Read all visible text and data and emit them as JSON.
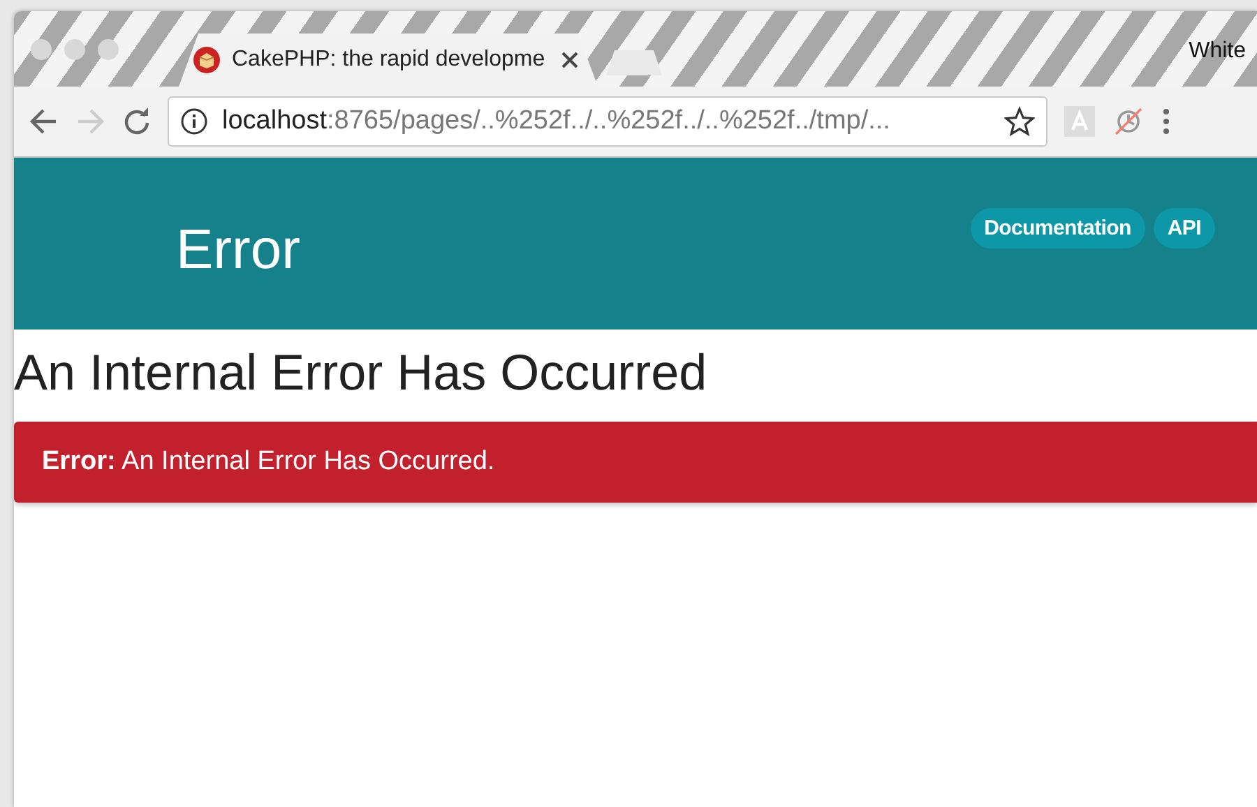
{
  "window": {
    "title_bar_label": "White"
  },
  "tabs": [
    {
      "title": "CakePHP: the rapid developme",
      "selected": true
    }
  ],
  "address_bar": {
    "host": "localhost",
    "path": ":8765/pages/..%252f../..%252f../..%252f../tmp/..."
  },
  "header": {
    "title": "Error",
    "links": [
      "Documentation",
      "API"
    ]
  },
  "page": {
    "heading": "An Internal Error Has Occurred",
    "alert": "**Error:** An Internal Error Has Occurred."
  }
}
